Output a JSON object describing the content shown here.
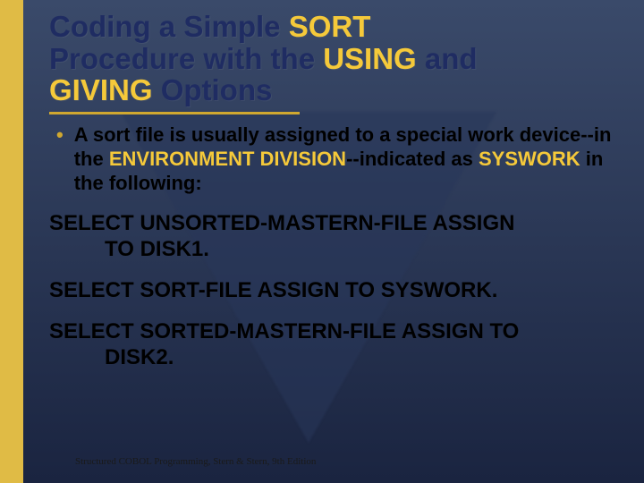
{
  "title": {
    "line1_pre": "Coding a Simple ",
    "line1_hl": "SORT",
    "line2_pre": "Procedure with the ",
    "line2_hl1": "USING",
    "line2_mid": " and ",
    "line3_hl": "GIVING",
    "line3_post": " Options"
  },
  "bullet": {
    "pre": "A sort file is usually assigned to a special work device--in the ",
    "hl1": "ENVIRONMENT DIVISION",
    "mid": "--indicated as ",
    "hl2": "SYSWORK",
    "post": " in the following:"
  },
  "code": {
    "l1a": "SELECT UNSORTED-MASTERN-FILE ASSIGN",
    "l1b": "TO DISK1.",
    "l2": "SELECT SORT-FILE ASSIGN TO SYSWORK.",
    "l3a": "SELECT SORTED-MASTERN-FILE ASSIGN TO",
    "l3b": "DISK2."
  },
  "footer": "Structured COBOL Programming, Stern & Stern, 9th Edition"
}
